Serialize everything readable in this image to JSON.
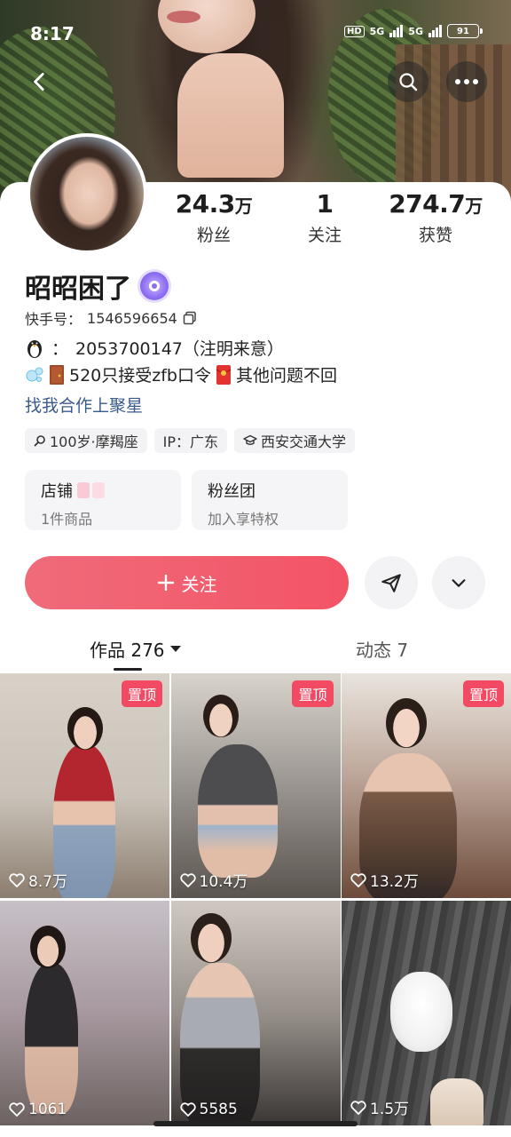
{
  "status_bar": {
    "time": "8:17",
    "hd_label": "HD",
    "net1": "5G",
    "net2": "5G",
    "battery": "91"
  },
  "nav": {
    "back_icon": "chevron-left-icon",
    "search_icon": "search-icon",
    "more_icon": "more-horizontal-icon"
  },
  "profile": {
    "name": "昭昭困了",
    "kuaishou_id_label": "快手号：",
    "kuaishou_id": "1546596654",
    "bio_qq_label": "：",
    "bio_qq": "2053700147（注明来意）",
    "bio_line2_a": "520只接受zfb口令",
    "bio_line2_b": "其他问题不回",
    "link_text": "找我合作上聚星"
  },
  "stats": [
    {
      "value": "24.3",
      "unit": "万",
      "label": "粉丝"
    },
    {
      "value": "1",
      "unit": "",
      "label": "关注"
    },
    {
      "value": "274.7",
      "unit": "万",
      "label": "获赞"
    }
  ],
  "tags": [
    {
      "icon": "search-icon",
      "text": "100岁·摩羯座"
    },
    {
      "icon": "",
      "text": "IP：广东"
    },
    {
      "icon": "graduation-cap-icon",
      "text": "西安交通大学"
    }
  ],
  "mini_cards": [
    {
      "title": "店铺",
      "subtitle": "1件商品"
    },
    {
      "title": "粉丝团",
      "subtitle": "加入享特权"
    }
  ],
  "actions": {
    "follow_label": "关注"
  },
  "tabs": {
    "works_label": "作品 276",
    "moments_label": "动态 7"
  },
  "grid": [
    {
      "pinned": "置顶",
      "likes": "8.7万"
    },
    {
      "pinned": "置顶",
      "likes": "10.4万"
    },
    {
      "pinned": "置顶",
      "likes": "13.2万"
    },
    {
      "pinned": "",
      "likes": "1061"
    },
    {
      "pinned": "",
      "likes": "5585"
    },
    {
      "pinned": "",
      "likes": "1.5万"
    }
  ],
  "colors": {
    "accent": "#f25466",
    "pin_badge": "#f24a63",
    "link": "#3a5a8c",
    "verified_badge": "#8d6ef2"
  }
}
